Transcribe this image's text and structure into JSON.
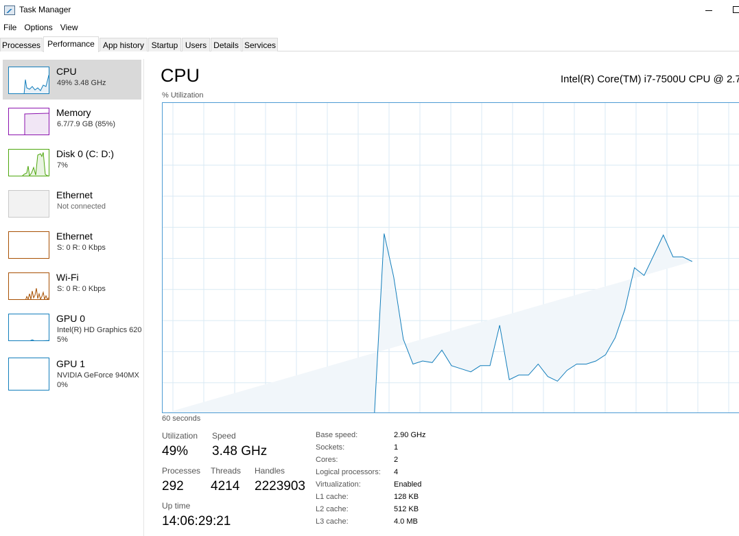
{
  "window": {
    "title": "Task Manager"
  },
  "menu": [
    "File",
    "Options",
    "View"
  ],
  "tabs": [
    "Processes",
    "Performance",
    "App history",
    "Startup",
    "Users",
    "Details",
    "Services"
  ],
  "sidebar": {
    "items": [
      {
        "name": "CPU",
        "sub1": "49%  3.48 GHz",
        "color": "#117dbb"
      },
      {
        "name": "Memory",
        "sub1": "6.7/7.9 GB (85%)",
        "color": "#8b12ae"
      },
      {
        "name": "Disk 0 (C: D:)",
        "sub1": "7%",
        "color": "#4da60c"
      },
      {
        "name": "Ethernet",
        "sub1": "Not connected",
        "color": "#a0a0a0"
      },
      {
        "name": "Ethernet",
        "sub1": "S: 0  R: 0 Kbps",
        "color": "#a74f01"
      },
      {
        "name": "Wi-Fi",
        "sub1": "S: 0  R: 0 Kbps",
        "color": "#a74f01"
      },
      {
        "name": "GPU 0",
        "sub1": "Intel(R) HD Graphics 620",
        "sub2": "5%",
        "color": "#117dbb"
      },
      {
        "name": "GPU 1",
        "sub1": "NVIDIA GeForce 940MX",
        "sub2": "0%",
        "color": "#117dbb"
      }
    ]
  },
  "main": {
    "title": "CPU",
    "model": "Intel(R) Core(TM) i7-7500U CPU @ 2.7",
    "axis_label": "% Utilization",
    "time_label": "60 seconds",
    "stats": {
      "utilization_label": "Utilization",
      "utilization": "49%",
      "speed_label": "Speed",
      "speed": "3.48 GHz",
      "processes_label": "Processes",
      "processes": "292",
      "threads_label": "Threads",
      "threads": "4214",
      "handles_label": "Handles",
      "handles": "2223903",
      "uptime_label": "Up time",
      "uptime": "14:06:29:21"
    },
    "info": [
      {
        "key": "Base speed:",
        "value": "2.90 GHz"
      },
      {
        "key": "Sockets:",
        "value": "1"
      },
      {
        "key": "Cores:",
        "value": "2"
      },
      {
        "key": "Logical processors:",
        "value": "4"
      },
      {
        "key": "Virtualization:",
        "value": "Enabled"
      },
      {
        "key": "L1 cache:",
        "value": "128 KB"
      },
      {
        "key": "L2 cache:",
        "value": "512 KB"
      },
      {
        "key": "L3 cache:",
        "value": "4.0 MB"
      }
    ]
  },
  "chart_data": {
    "type": "area",
    "ylim": [
      0,
      100
    ],
    "xlim": [
      60,
      0
    ],
    "grid": true,
    "color": "#117dbb",
    "x": [
      60,
      38,
      37,
      36,
      35,
      34,
      33,
      32,
      31,
      30,
      29,
      28,
      27,
      26,
      25,
      24,
      23,
      22,
      21,
      20,
      19,
      18,
      17,
      16,
      15,
      14,
      13,
      12,
      11,
      10,
      9,
      8,
      7,
      6,
      5,
      4,
      3,
      2,
      1,
      0
    ],
    "y": [
      0,
      0,
      58,
      44,
      24,
      16,
      17,
      16.5,
      20.5,
      15.5,
      14.5,
      13.5,
      15.5,
      15.5,
      28.5,
      11,
      12.5,
      12.5,
      16,
      12,
      10.5,
      14,
      16,
      16,
      17,
      19,
      24.5,
      33.5,
      47,
      44.5,
      51,
      57.5,
      50.5,
      50.5,
      49
    ]
  }
}
